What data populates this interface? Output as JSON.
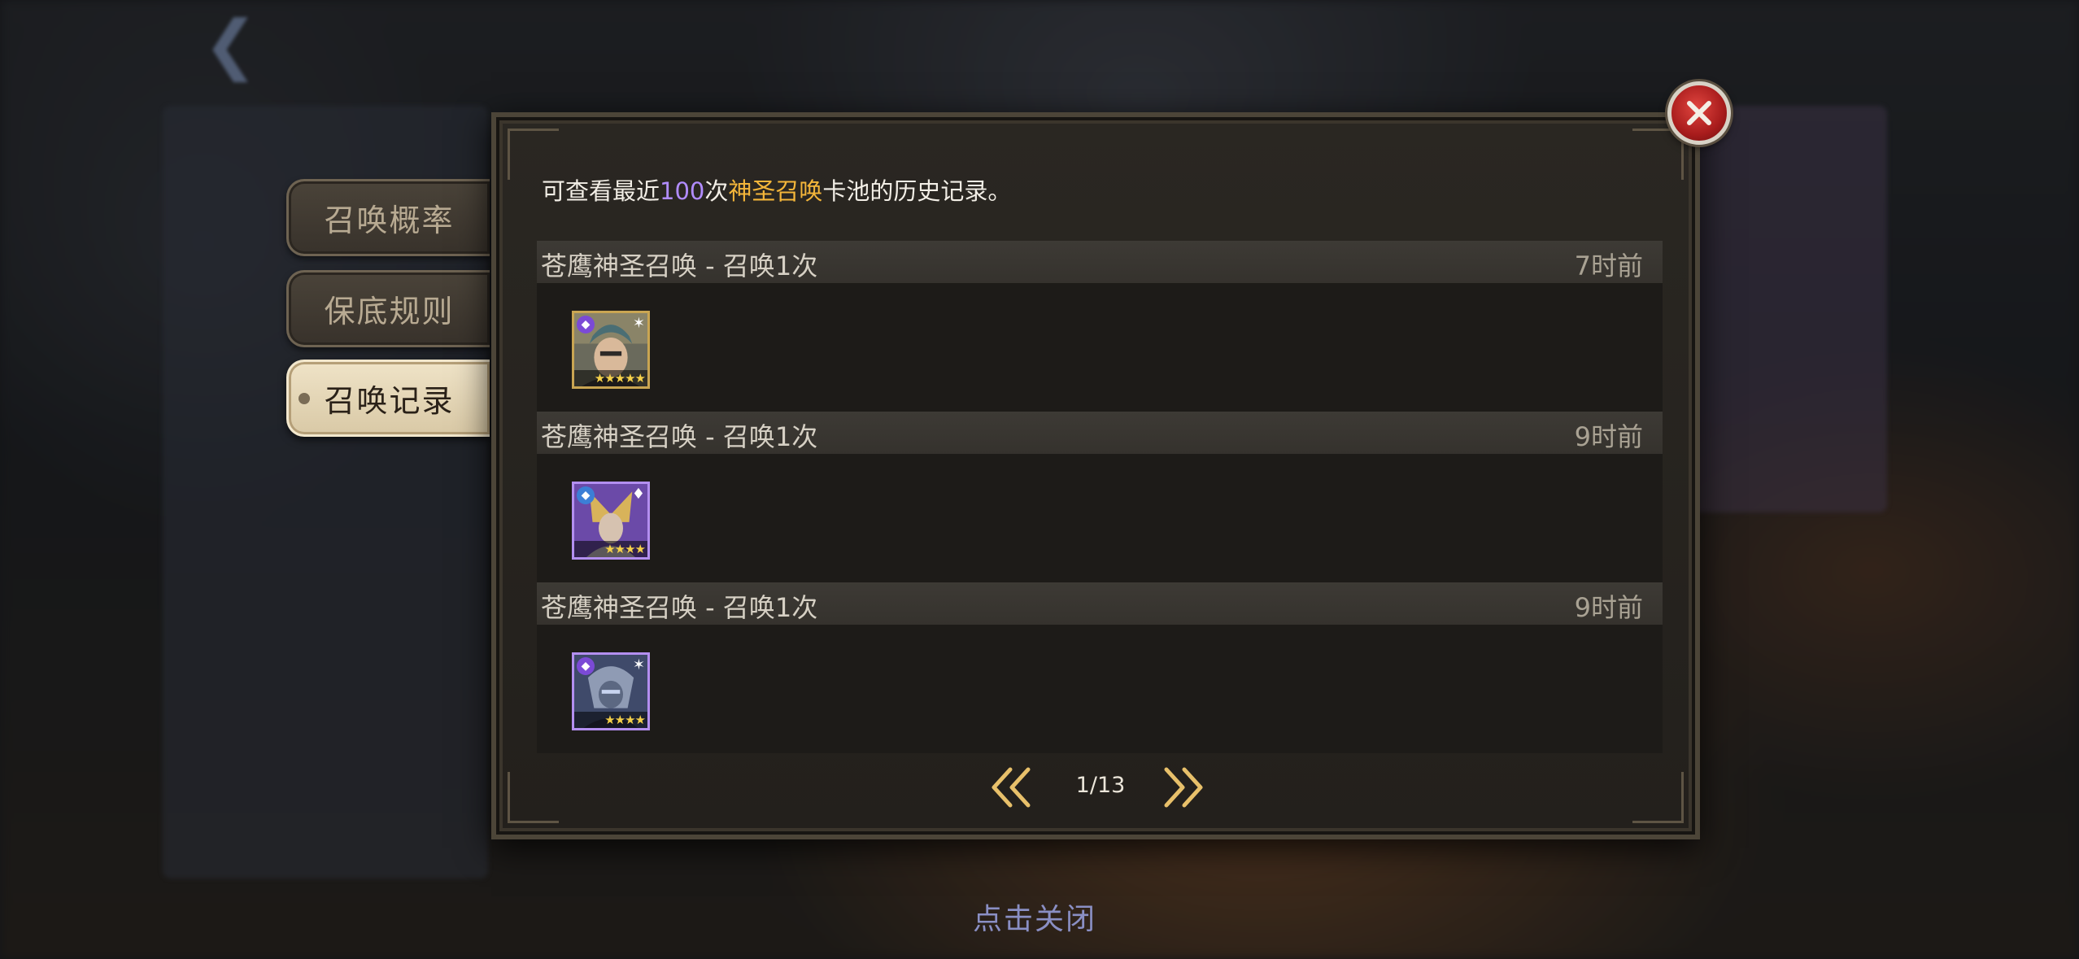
{
  "tabs": [
    {
      "label": "召唤概率",
      "active": false
    },
    {
      "label": "保底规则",
      "active": false
    },
    {
      "label": "召唤记录",
      "active": true
    }
  ],
  "intro": {
    "prefix": "可查看最近",
    "count": "100",
    "mid": "次",
    "pool": "神圣召唤",
    "suffix": "卡池的历史记录。"
  },
  "records": [
    {
      "title": "苍鹰神圣召唤 - 召唤1次",
      "time": "7时前",
      "hero": {
        "icon": "hero-portrait-icon",
        "stars": "★★★★★",
        "frame": "gold"
      }
    },
    {
      "title": "苍鹰神圣召唤 - 召唤1次",
      "time": "9时前",
      "hero": {
        "icon": "hero-portrait-icon",
        "stars": "★★★★",
        "frame": "purple"
      }
    },
    {
      "title": "苍鹰神圣召唤 - 召唤1次",
      "time": "9时前",
      "hero": {
        "icon": "hero-portrait-icon",
        "stars": "★★★★",
        "frame": "purple"
      }
    }
  ],
  "pagination": {
    "current": "1/13"
  },
  "footer": {
    "close_hint": "点击关闭"
  },
  "colors": {
    "highlight_purple": "#b18cff",
    "highlight_gold": "#f4b63a",
    "close_red": "#c42a26"
  }
}
